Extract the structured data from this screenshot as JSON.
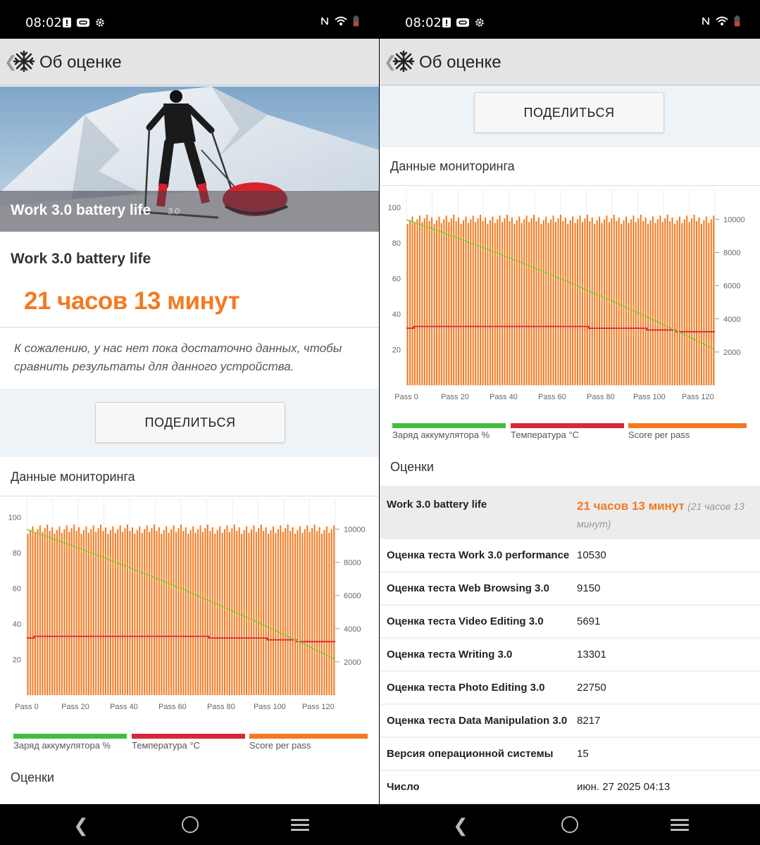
{
  "status": {
    "time": "08:02"
  },
  "appbar": {
    "title": "Об оценке"
  },
  "hero": {
    "title": "Work 3.0 battery life",
    "version": "3.0"
  },
  "result": {
    "title": "Work 3.0 battery life",
    "value": "21 часов 13 минут"
  },
  "note": "К сожалению, у нас нет пока достаточно данных, чтобы сравнить результаты для данного устройства.",
  "share_label": "ПОДЕЛИТЬСЯ",
  "monitoring_title": "Данные мониторинга",
  "ratings_title": "Оценки",
  "colors": {
    "accent": "#f47920",
    "battery": "#3fbf3f",
    "temperature": "#d8283a",
    "score": "#f47920"
  },
  "chart_data": {
    "type": "bar",
    "x_tick_labels": [
      "Pass 0",
      "Pass 20",
      "Pass 40",
      "Pass 60",
      "Pass 80",
      "Pass 100",
      "Pass 120"
    ],
    "y_left_ticks": [
      "20",
      "40",
      "60",
      "80",
      "100"
    ],
    "y_right_ticks": [
      "2000",
      "4000",
      "6000",
      "8000",
      "10000"
    ],
    "series": [
      {
        "name": "Заряд аккумулятора %",
        "type": "line",
        "start": 93,
        "end": 20
      },
      {
        "name": "Температура °C",
        "type": "line",
        "values_segments": [
          [
            0,
            2,
            32
          ],
          [
            3,
            74,
            33
          ],
          [
            75,
            98,
            32
          ],
          [
            99,
            110,
            31
          ],
          [
            111,
            126,
            30
          ]
        ]
      },
      {
        "name": "Score per pass",
        "type": "bar",
        "approx_value": 10000,
        "count": 127
      }
    ],
    "ylim_left": [
      0,
      110
    ],
    "ylim_right": [
      0,
      11800
    ]
  },
  "table": [
    {
      "label": "Work 3.0 battery life",
      "value": "21 часов 13 минут",
      "value_sub": "(21 часов 13 минут)"
    },
    {
      "label": "Оценка теста Work 3.0 performance",
      "value": "10530"
    },
    {
      "label": "Оценка теста Web Browsing 3.0",
      "value": "9150"
    },
    {
      "label": "Оценка теста Video Editing 3.0",
      "value": "5691"
    },
    {
      "label": "Оценка теста Writing 3.0",
      "value": "13301"
    },
    {
      "label": "Оценка теста Photo Editing 3.0",
      "value": "22750"
    },
    {
      "label": "Оценка теста Data Manipulation 3.0",
      "value": "8217"
    },
    {
      "label": "Версия операционной системы",
      "value": "15"
    },
    {
      "label": "Число",
      "value": "июн. 27 2025 04:13"
    }
  ]
}
